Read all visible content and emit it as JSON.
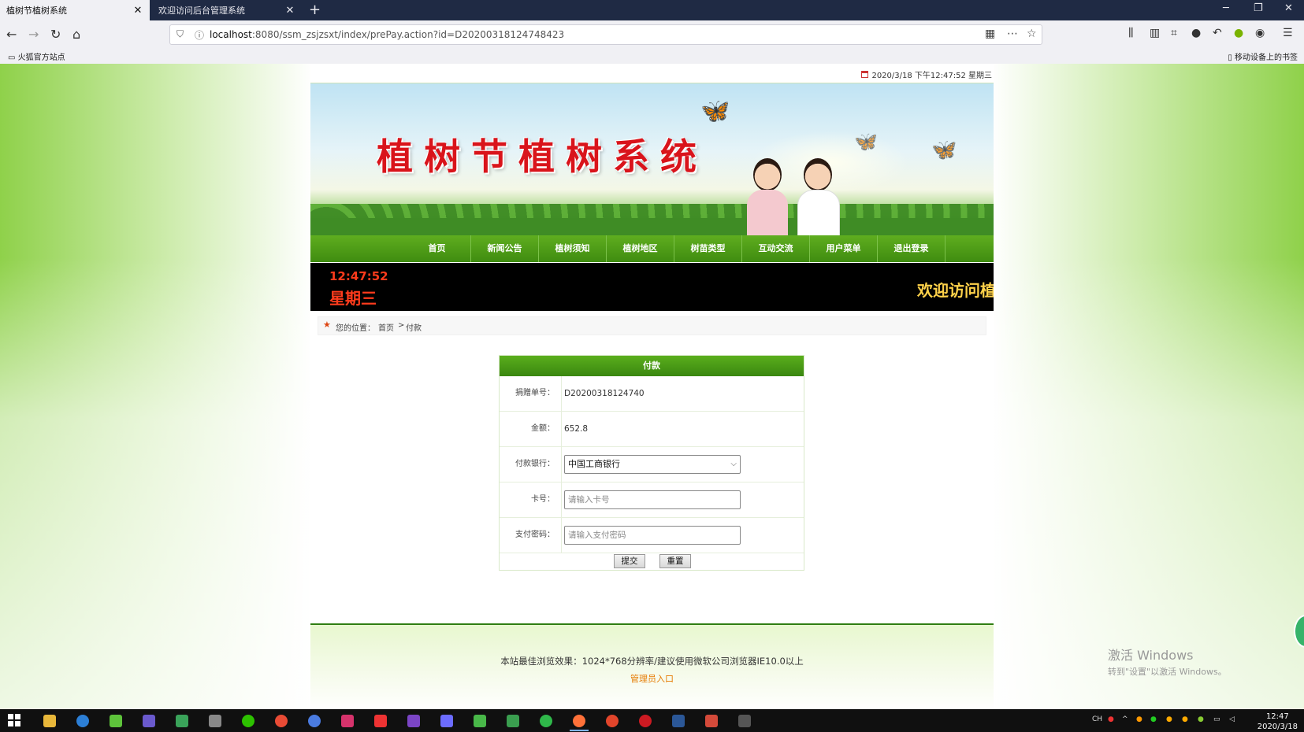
{
  "browser": {
    "tabs": [
      {
        "label": "植树节植树系统",
        "close": "✕"
      },
      {
        "label": "欢迎访问后台管理系统",
        "close": "✕"
      }
    ],
    "new_tab": "+",
    "url_host": "localhost",
    "url_rest": ":8080/ssm_zsjzsxt/index/prePay.action?id=D20200318124748423",
    "bookmark_left": "火狐官方站点",
    "bookmark_right": "移动设备上的书签"
  },
  "header": {
    "datetime": "2020/3/18 下午12:47:52 星期三",
    "site_title": "植树节植树系统"
  },
  "menu": [
    {
      "label": "首页"
    },
    {
      "label": "新闻公告"
    },
    {
      "label": "植树须知"
    },
    {
      "label": "植树地区"
    },
    {
      "label": "树苗类型"
    },
    {
      "label": "互动交流"
    },
    {
      "label": "用户菜单"
    },
    {
      "label": "退出登录"
    }
  ],
  "clock": {
    "time": "12:47:52",
    "day": "星期三",
    "marquee": "欢迎访问植"
  },
  "breadcrumb": {
    "label": "您的位置：",
    "home": "首页",
    "sep": ">",
    "current": "付款"
  },
  "form": {
    "title": "付款",
    "order_label": "捐赠单号：",
    "order_value": "D20200318124740",
    "amount_label": "金额：",
    "amount_value": "652.8",
    "bank_label": "付款银行：",
    "bank_value": "中国工商银行",
    "card_label": "卡号：",
    "card_placeholder": "请输入卡号",
    "pwd_label": "支付密码：",
    "pwd_placeholder": "请输入支付密码",
    "submit_label": "提交",
    "reset_label": "重置"
  },
  "footer": {
    "note": "本站最佳浏览效果：1024*768分辨率/建议使用微软公司浏览器IE10.0以上",
    "admin_link": "管理员入口"
  },
  "watermark": {
    "line1": "激活 Windows",
    "line2": "转到\"设置\"以激活 Windows。"
  },
  "taskbar": {
    "tray_lang": "CH",
    "time": "12:47",
    "date": "2020/3/18"
  }
}
